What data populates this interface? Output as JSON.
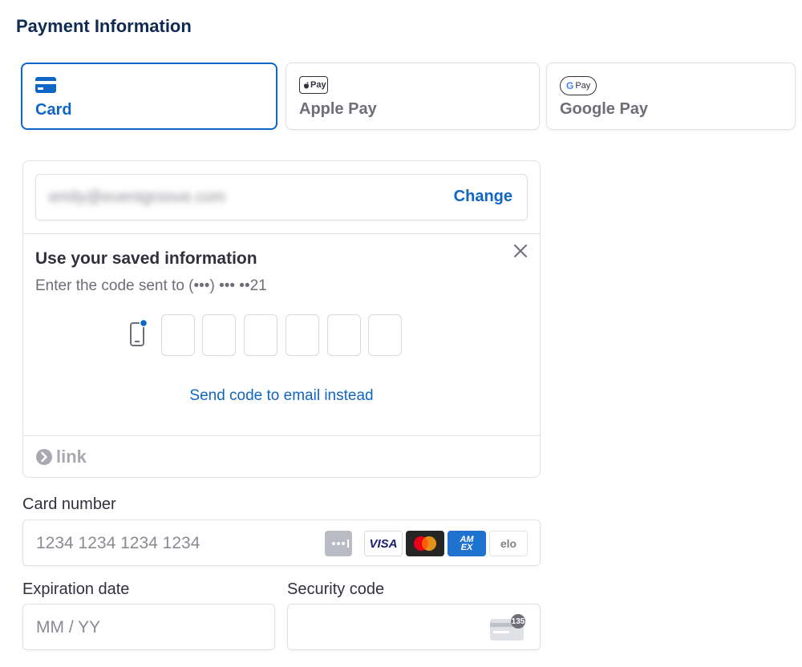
{
  "header": {
    "title": "Payment Information"
  },
  "tabs": [
    {
      "label": "Card",
      "icon": "card-icon",
      "selected": true
    },
    {
      "label": "Apple Pay",
      "icon": "apple-pay-logo",
      "badge": "Pay",
      "selected": false
    },
    {
      "label": "Google Pay",
      "icon": "google-pay-logo",
      "badge": "Pay",
      "badge_g": "G",
      "selected": false
    }
  ],
  "link_panel": {
    "email": "emily@eventgroove.com",
    "change_label": "Change",
    "saved_title": "Use your saved information",
    "saved_subtitle": "Enter the code sent to (•••) ••• ••21",
    "otp_count": 6,
    "send_email_label": "Send code to email instead",
    "brand_label": "link"
  },
  "card_number": {
    "label": "Card number",
    "placeholder": "1234 1234 1234 1234",
    "brands": [
      "generic-card-icon",
      "visa-logo",
      "mastercard-logo",
      "amex-logo",
      "elo-logo"
    ],
    "visa_text": "VISA",
    "amex_text": "AM EX",
    "elo_text": "elo"
  },
  "expiration": {
    "label": "Expiration date",
    "placeholder": "MM / YY"
  },
  "security": {
    "label": "Security code",
    "placeholder": "",
    "cvc_hint": "135"
  },
  "colors": {
    "accent": "#1066c4",
    "title": "#0e2a52",
    "border": "#e0e0e0",
    "muted": "#6d6e78"
  }
}
